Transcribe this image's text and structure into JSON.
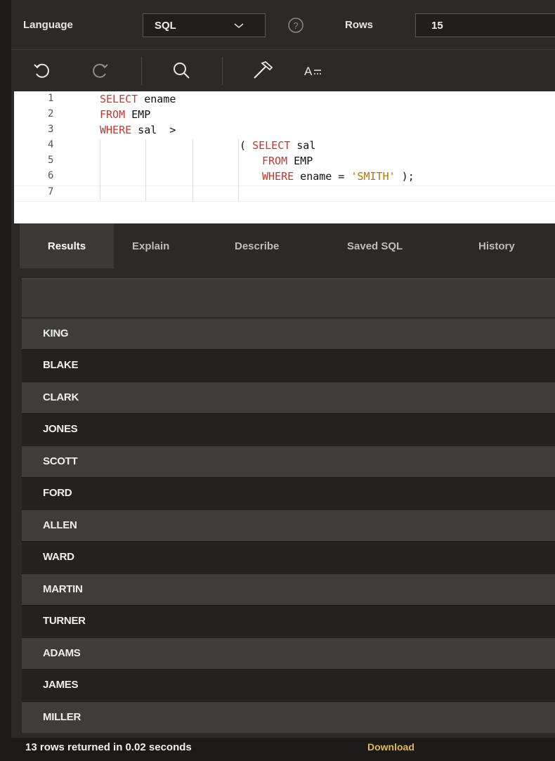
{
  "toolbar": {
    "language_label": "Language",
    "language_value": "SQL",
    "rows_label": "Rows",
    "rows_value": "15"
  },
  "editor": {
    "lines": [
      {
        "num": "1"
      },
      {
        "num": "2"
      },
      {
        "num": "3"
      },
      {
        "num": "4"
      },
      {
        "num": "5"
      },
      {
        "num": "6"
      },
      {
        "num": "7"
      }
    ],
    "tokens": {
      "l1_kw": "SELECT",
      "l1_rest": " ename",
      "l2_kw": "FROM",
      "l2_rest": " EMP",
      "l3_kw": "WHERE",
      "l3_rest": " sal  >",
      "l4_pre": "( ",
      "l4_kw": "SELECT",
      "l4_rest": " sal",
      "l5_kw": "FROM",
      "l5_rest": " EMP",
      "l6_kw": "WHERE",
      "l6_mid": " ename = ",
      "l6_str": "'SMITH'",
      "l6_end": " );"
    }
  },
  "tabs": [
    "Results",
    "Explain",
    "Describe",
    "Saved SQL",
    "History"
  ],
  "results": {
    "rows": [
      "KING",
      "BLAKE",
      "CLARK",
      "JONES",
      "SCOTT",
      "FORD",
      "ALLEN",
      "WARD",
      "MARTIN",
      "TURNER",
      "ADAMS",
      "JAMES",
      "MILLER"
    ]
  },
  "status": {
    "text": "13 rows returned in 0.02 seconds",
    "download": "Download"
  }
}
